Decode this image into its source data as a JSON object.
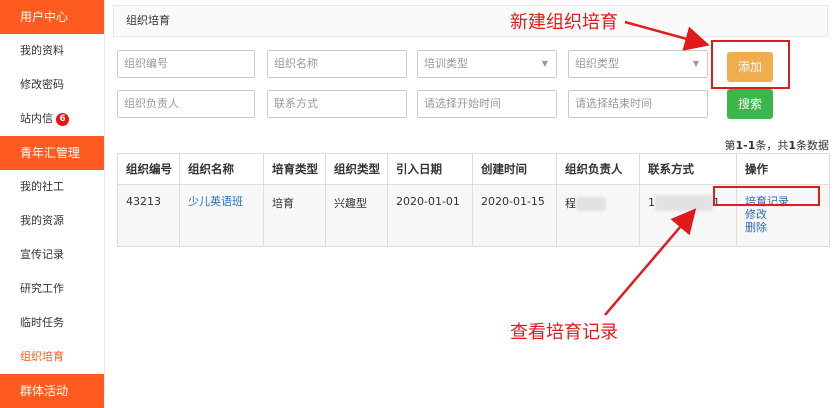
{
  "sidebar": {
    "group1_title": "用户中心",
    "items1": [
      {
        "label": "我的资料"
      },
      {
        "label": "修改密码"
      },
      {
        "label": "站内信",
        "badge": "6"
      }
    ],
    "group2_title": "青年汇管理",
    "items2": [
      {
        "label": "我的社工"
      },
      {
        "label": "我的资源"
      },
      {
        "label": "宣传记录"
      },
      {
        "label": "研究工作"
      },
      {
        "label": "临时任务"
      },
      {
        "label": "组织培育"
      }
    ],
    "group3_title": "群体活动"
  },
  "main": {
    "page_title": "组织培育",
    "filters": {
      "org_code_placeholder": "组织编号",
      "org_name_placeholder": "组织名称",
      "train_type_placeholder": "培训类型",
      "org_type_placeholder": "组织类型",
      "owner_placeholder": "组织负责人",
      "contact_placeholder": "联系方式",
      "start_time_placeholder": "请选择开始时间",
      "end_time_placeholder": "请选择结束时间"
    },
    "add_label": "添加",
    "search_label": "搜索",
    "count_prefix": "第",
    "count_range": "1-1",
    "count_mid": "条，共",
    "count_total": "1",
    "count_suffix": "条数据",
    "table": {
      "headers": [
        "组织编号",
        "组织名称",
        "培育类型",
        "组织类型",
        "引入日期",
        "创建时间",
        "组织负责人",
        "联系方式",
        "操作"
      ],
      "row": {
        "code": "43213",
        "name": "少儿英语班",
        "cultivate_type": "培育",
        "org_type": "兴趣型",
        "intro_date": "2020-01-01",
        "created": "2020-01-15",
        "owner_visible": "程",
        "contact_visible_start": "1",
        "contact_visible_end": "1",
        "actions": [
          "培育记录",
          "修改",
          "删除"
        ]
      }
    }
  },
  "annotations": {
    "top": "新建组织培育",
    "bottom": "查看培育记录",
    "color": "#e01b1b"
  }
}
